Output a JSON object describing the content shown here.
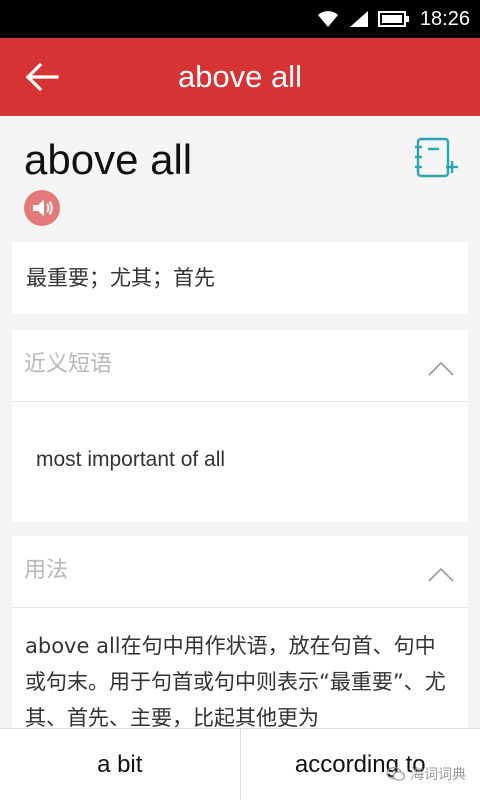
{
  "status_bar": {
    "time": "18:26",
    "icons": [
      "wifi-icon",
      "signal-icon",
      "battery-icon"
    ]
  },
  "app_bar": {
    "title": "above all",
    "back_icon": "arrow-left-icon"
  },
  "entry": {
    "headword": "above all",
    "meaning": "最重要；尤其；首先"
  },
  "synonyms": {
    "section_title": "近义短语",
    "items": [
      "most important of all"
    ]
  },
  "usage": {
    "section_title": "用法",
    "text": "above all在句中用作状语，放在句首、句中或句末。用于句首或句中则表示“最重要”、尤其、首先、主要，比起其他更为"
  },
  "bottom_nav": {
    "prev": "a bit",
    "next": "according to"
  },
  "watermark": "海词词典",
  "colors": {
    "primary": "#d63434",
    "speaker": "#e37a7a",
    "notebook_icon": "#2aa6b3",
    "muted_text": "#b8b8b8"
  }
}
